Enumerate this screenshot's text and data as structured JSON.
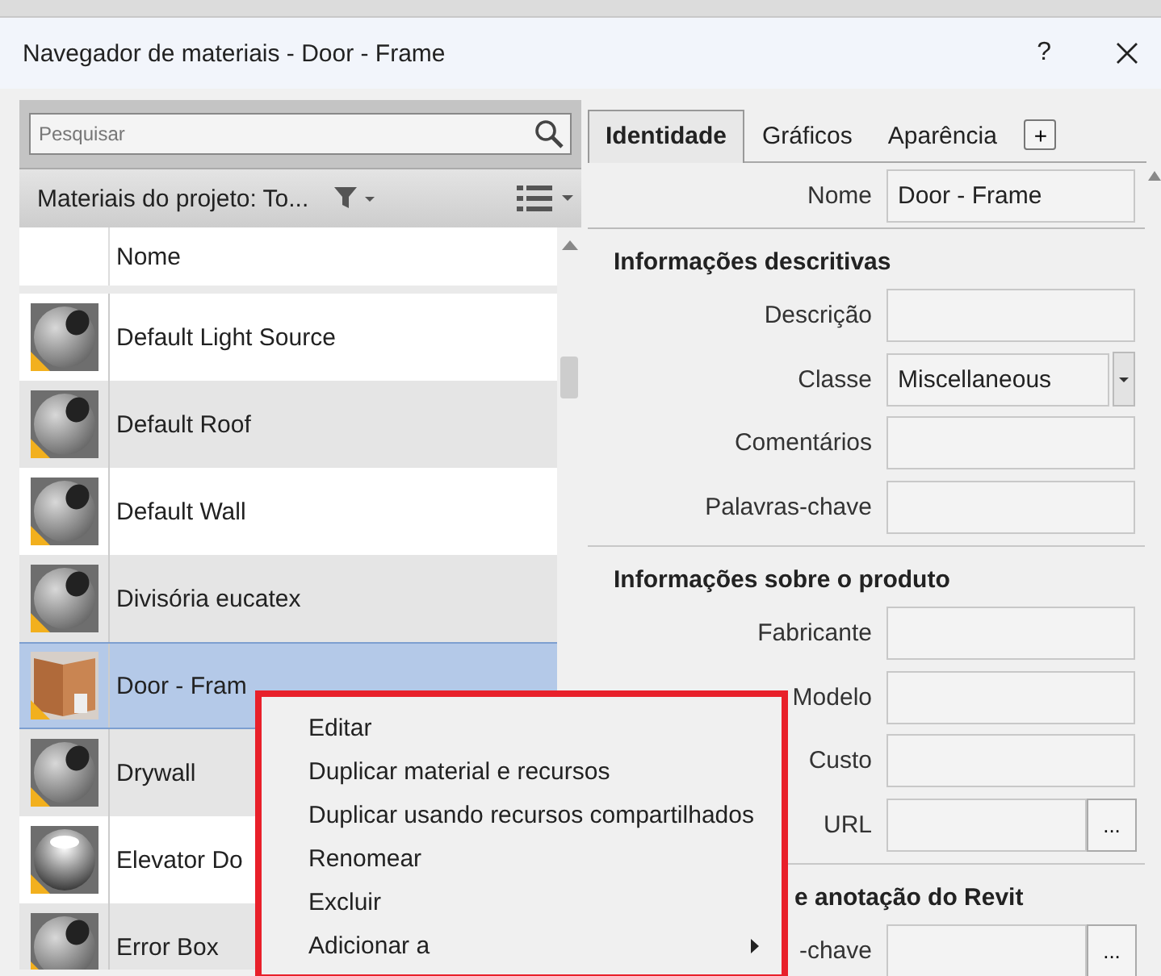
{
  "window": {
    "title": "Navegador de materiais - Door - Frame",
    "help": "?"
  },
  "search": {
    "placeholder": "Pesquisar"
  },
  "library": {
    "label": "Materiais do projeto: To..."
  },
  "list": {
    "column": "Nome",
    "rows": [
      {
        "name": "Default Light Source",
        "kind": "sphere",
        "selected": false
      },
      {
        "name": "Default Roof",
        "kind": "sphere",
        "selected": false
      },
      {
        "name": "Default Wall",
        "kind": "sphere",
        "selected": false
      },
      {
        "name": "Divisória eucatex",
        "kind": "sphere",
        "selected": false
      },
      {
        "name": "Door - Fram",
        "kind": "door",
        "selected": true
      },
      {
        "name": "Drywall",
        "kind": "sphere",
        "selected": false
      },
      {
        "name": "Elevator Do",
        "kind": "chrome",
        "selected": false
      },
      {
        "name": "Error Box",
        "kind": "sphere",
        "selected": false
      }
    ]
  },
  "tabs": [
    {
      "label": "Identidade",
      "selected": true
    },
    {
      "label": "Gráficos",
      "selected": false
    },
    {
      "label": "Aparência",
      "selected": false
    }
  ],
  "add_tab": "+",
  "name_field": {
    "label": "Nome",
    "value": "Door - Frame"
  },
  "sections": [
    {
      "title": "Informações descritivas",
      "fields": [
        {
          "label": "Descrição",
          "kind": "text"
        },
        {
          "label": "Classe",
          "kind": "dropdown",
          "value": "Miscellaneous"
        },
        {
          "label": "Comentários",
          "kind": "text"
        },
        {
          "label": "Palavras-chave",
          "kind": "text"
        }
      ]
    },
    {
      "title": "Informações sobre o produto",
      "fields": [
        {
          "label": "Fabricante",
          "kind": "text"
        },
        {
          "label": "Modelo",
          "kind": "text"
        },
        {
          "label": "Custo",
          "kind": "text"
        },
        {
          "label": "URL",
          "kind": "browse",
          "button": "..."
        }
      ]
    },
    {
      "title": "e anotação do Revit",
      "covered": true,
      "fields": [
        {
          "label": "-chave",
          "kind": "browse",
          "button": "..."
        }
      ]
    }
  ],
  "context_menu": {
    "items": [
      {
        "label": "Editar",
        "submenu": false
      },
      {
        "label": "Duplicar material e recursos",
        "submenu": false
      },
      {
        "label": "Duplicar usando recursos compartilhados",
        "submenu": false
      },
      {
        "label": "Renomear",
        "submenu": false
      },
      {
        "label": "Excluir",
        "submenu": false
      },
      {
        "label": "Adicionar a",
        "submenu": true
      }
    ]
  }
}
